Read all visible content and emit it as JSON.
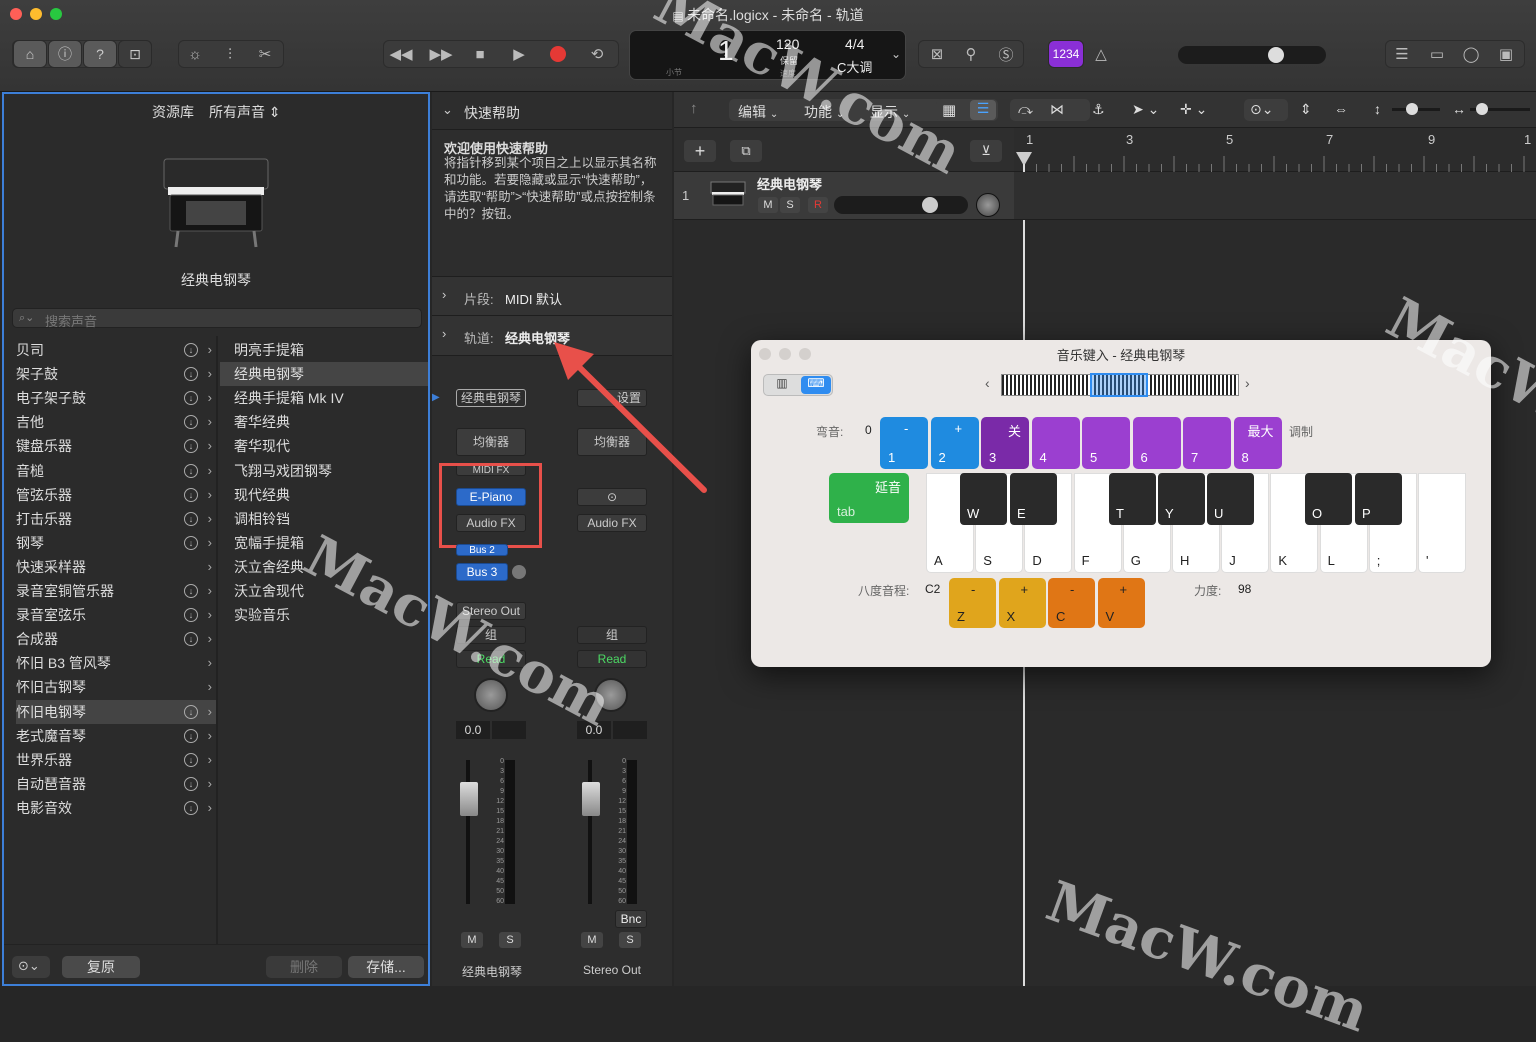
{
  "window": {
    "title": "未命名.logicx - 未命名 - 轨道"
  },
  "lcd": {
    "bar": "1",
    "bar_label": "小节",
    "tempo": "120",
    "tempo_mode": "保留",
    "tempo_label": "速度",
    "signature": "4/4",
    "key": "C大调",
    "count_in": "1234"
  },
  "library": {
    "header_label": "资源库",
    "filter_label": "所有声音",
    "patch_name": "经典电钢琴",
    "search_placeholder": "搜索声音",
    "categories": [
      "贝司",
      "架子鼓",
      "电子架子鼓",
      "吉他",
      "键盘乐器",
      "音槌",
      "管弦乐器",
      "打击乐器",
      "钢琴",
      "快速采样器",
      "录音室铜管乐器",
      "录音室弦乐",
      "合成器",
      "怀旧 B3 管风琴",
      "怀旧古钢琴",
      "怀旧电钢琴",
      "老式魔音琴",
      "世界乐器",
      "自动琶音器",
      "电影音效"
    ],
    "patches": [
      "明亮手提箱",
      "经典电钢琴",
      "经典手提箱 Mk IV",
      "奢华经典",
      "奢华现代",
      "飞翔马戏团钢琴",
      "现代经典",
      "调相铃铛",
      "宽幅手提箱",
      "沃立舍经典",
      "沃立舍现代",
      "实验音乐"
    ],
    "footer": {
      "revert": "复原",
      "delete": "删除",
      "save": "存储..."
    }
  },
  "quick_help": {
    "title": "快速帮助",
    "heading": "欢迎使用快速帮助",
    "body": "将指针移到某个项目之上以显示其名称和功能。若要隐藏或显示“快速帮助”，请选取“帮助”>“快速帮助”或点按控制条中的？按钮。",
    "region_label": "片段:",
    "region_value": "MIDI 默认",
    "track_label": "轨道:",
    "track_value": "经典电钢琴"
  },
  "mixer": {
    "ch1": {
      "setting": "经典电钢琴",
      "eq": "均衡器",
      "midi_fx": "MIDI FX",
      "instrument": "E-Piano",
      "audio_fx": "Audio FX",
      "bus2": "Bus 2",
      "bus3": "Bus 3",
      "output": "Stereo Out",
      "group": "组",
      "automation": "Read",
      "volume": "0.0",
      "mute": "M",
      "solo": "S",
      "name": "经典电钢琴"
    },
    "ch2": {
      "setting": "设置",
      "eq": "均衡器",
      "audio_fx": "Audio FX",
      "group": "组",
      "automation": "Read",
      "volume": "0.0",
      "bounce": "Bnc",
      "mute": "M",
      "solo": "S",
      "name": "Stereo Out"
    },
    "fader_scale": [
      "0",
      "3",
      "6",
      "9",
      "12",
      "15",
      "18",
      "21",
      "24",
      "30",
      "35",
      "40",
      "45",
      "50",
      "60"
    ]
  },
  "tracks": {
    "menu": {
      "edit": "编辑",
      "functions": "功能",
      "view": "显示"
    },
    "ruler": [
      "1",
      "3",
      "5",
      "7",
      "9",
      "1"
    ],
    "track": {
      "number": "1",
      "name": "经典电钢琴",
      "mute": "M",
      "solo": "S",
      "record": "R"
    }
  },
  "musical_typing": {
    "title": "音乐键入 - 经典电钢琴",
    "pitch_bend_label": "弯音:",
    "pitch_bend_value": "0",
    "modulation_label": "调制",
    "pitch_keys": [
      {
        "sym": "-",
        "num": "1",
        "color": "#1f8be0"
      },
      {
        "sym": "+",
        "num": "2",
        "color": "#1f8be0"
      },
      {
        "sym": "关",
        "num": "3",
        "color": "#7a2aa8"
      },
      {
        "sym": "",
        "num": "4",
        "color": "#9b3fd0"
      },
      {
        "sym": "",
        "num": "5",
        "color": "#9b3fd0"
      },
      {
        "sym": "",
        "num": "6",
        "color": "#9b3fd0"
      },
      {
        "sym": "",
        "num": "7",
        "color": "#9b3fd0"
      },
      {
        "sym": "最大",
        "num": "8",
        "color": "#9b3fd0"
      }
    ],
    "sustain": {
      "label": "延音",
      "key": "tab",
      "color": "#2fb14a"
    },
    "white_keys": [
      "A",
      "S",
      "D",
      "F",
      "G",
      "H",
      "J",
      "K",
      "L",
      ";",
      "'"
    ],
    "black_keys": [
      "W",
      "E",
      "T",
      "Y",
      "U",
      "O",
      "P"
    ],
    "octave_label": "八度音程:",
    "octave_value": "C2",
    "octave_keys": [
      {
        "sym": "-",
        "key": "Z",
        "color": "#e0a51c"
      },
      {
        "sym": "+",
        "key": "X",
        "color": "#e0a51c"
      },
      {
        "sym": "-",
        "key": "C",
        "color": "#e07615"
      },
      {
        "sym": "+",
        "key": "V",
        "color": "#e07615"
      }
    ],
    "velocity_label": "力度:",
    "velocity_value": "98"
  },
  "watermark": "MacW.com",
  "colors": {
    "accent": "#2c6ac9",
    "arrow": "#e8504a",
    "highlight_box": "#e8504a"
  }
}
